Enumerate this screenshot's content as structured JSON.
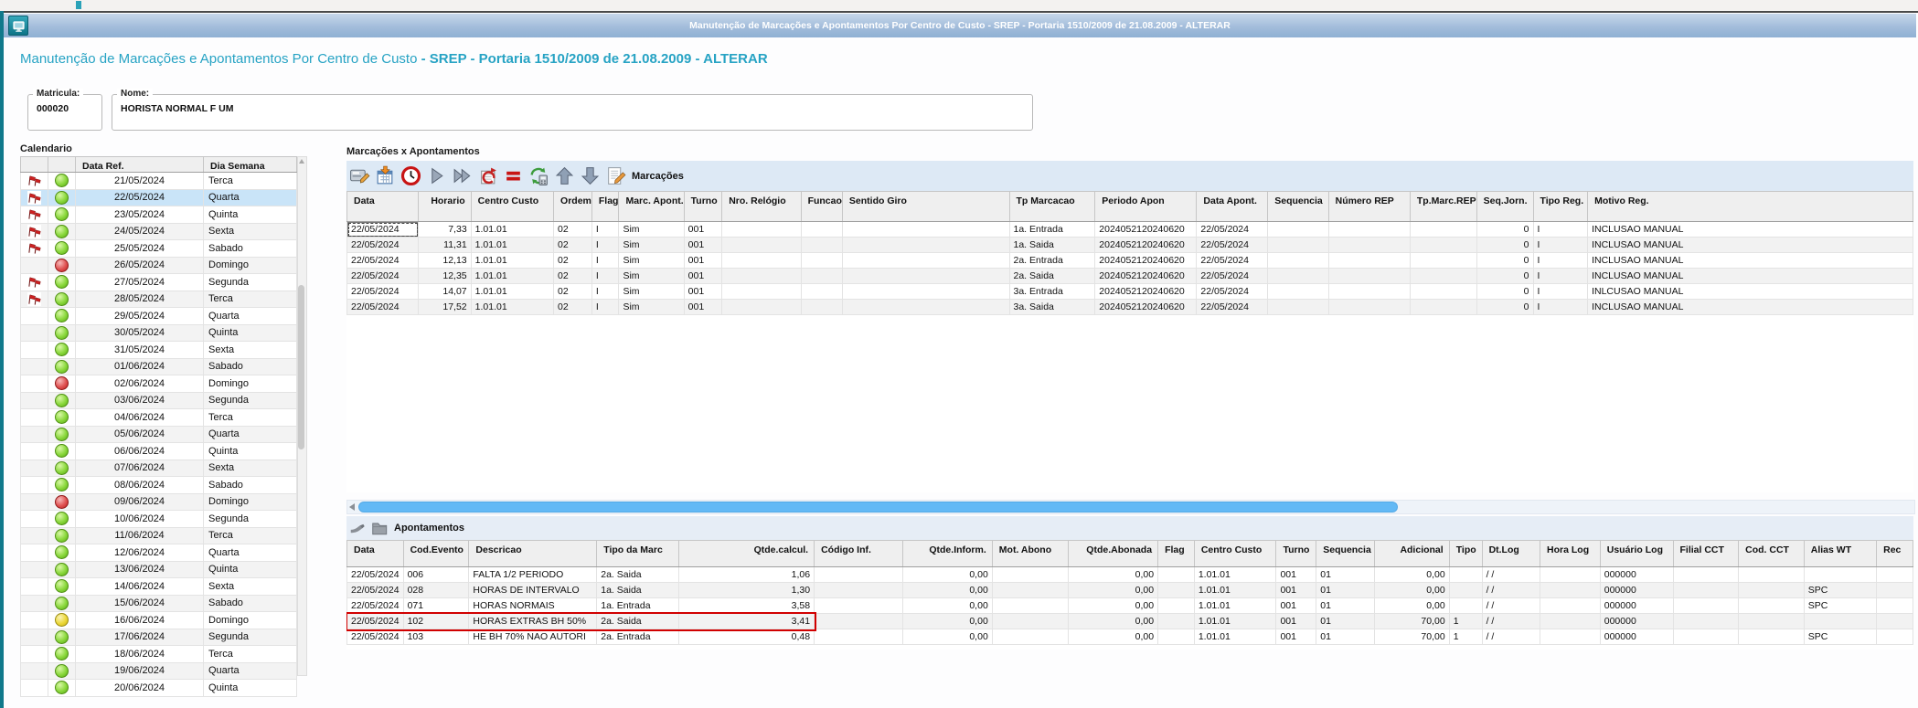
{
  "window": {
    "title": "Manutenção de Marcações e Apontamentos Por Centro de Custo - SREP - Portaria 1510/2009 de 21.08.2009 - ALTERAR"
  },
  "page": {
    "title_normal": "Manutenção de Marcações e Apontamentos Por Centro de Custo ",
    "title_bold": "- SREP - Portaria 1510/2009 de 21.08.2009 - ALTERAR"
  },
  "employee": {
    "matricula_label": "Matricula:",
    "matricula": "000020",
    "nome_label": "Nome:",
    "nome": "HORISTA NORMAL F UM"
  },
  "calendar": {
    "title": "Calendario",
    "columns": [
      "Data Ref.",
      "Dia Semana"
    ],
    "rows": [
      {
        "date": "21/05/2024",
        "day": "Terca",
        "status": "green",
        "flag": true,
        "selected": false
      },
      {
        "date": "22/05/2024",
        "day": "Quarta",
        "status": "green",
        "flag": true,
        "selected": true
      },
      {
        "date": "23/05/2024",
        "day": "Quinta",
        "status": "green",
        "flag": true,
        "selected": false
      },
      {
        "date": "24/05/2024",
        "day": "Sexta",
        "status": "green",
        "flag": true,
        "selected": false
      },
      {
        "date": "25/05/2024",
        "day": "Sabado",
        "status": "green",
        "flag": true,
        "selected": false
      },
      {
        "date": "26/05/2024",
        "day": "Domingo",
        "status": "red",
        "flag": false,
        "selected": false
      },
      {
        "date": "27/05/2024",
        "day": "Segunda",
        "status": "green",
        "flag": true,
        "selected": false
      },
      {
        "date": "28/05/2024",
        "day": "Terca",
        "status": "green",
        "flag": true,
        "selected": false
      },
      {
        "date": "29/05/2024",
        "day": "Quarta",
        "status": "green",
        "flag": false,
        "selected": false
      },
      {
        "date": "30/05/2024",
        "day": "Quinta",
        "status": "green",
        "flag": false,
        "selected": false
      },
      {
        "date": "31/05/2024",
        "day": "Sexta",
        "status": "green",
        "flag": false,
        "selected": false
      },
      {
        "date": "01/06/2024",
        "day": "Sabado",
        "status": "green",
        "flag": false,
        "selected": false
      },
      {
        "date": "02/06/2024",
        "day": "Domingo",
        "status": "red",
        "flag": false,
        "selected": false
      },
      {
        "date": "03/06/2024",
        "day": "Segunda",
        "status": "green",
        "flag": false,
        "selected": false
      },
      {
        "date": "04/06/2024",
        "day": "Terca",
        "status": "green",
        "flag": false,
        "selected": false
      },
      {
        "date": "05/06/2024",
        "day": "Quarta",
        "status": "green",
        "flag": false,
        "selected": false
      },
      {
        "date": "06/06/2024",
        "day": "Quinta",
        "status": "green",
        "flag": false,
        "selected": false
      },
      {
        "date": "07/06/2024",
        "day": "Sexta",
        "status": "green",
        "flag": false,
        "selected": false
      },
      {
        "date": "08/06/2024",
        "day": "Sabado",
        "status": "green",
        "flag": false,
        "selected": false
      },
      {
        "date": "09/06/2024",
        "day": "Domingo",
        "status": "red",
        "flag": false,
        "selected": false
      },
      {
        "date": "10/06/2024",
        "day": "Segunda",
        "status": "green",
        "flag": false,
        "selected": false
      },
      {
        "date": "11/06/2024",
        "day": "Terca",
        "status": "green",
        "flag": false,
        "selected": false
      },
      {
        "date": "12/06/2024",
        "day": "Quarta",
        "status": "green",
        "flag": false,
        "selected": false
      },
      {
        "date": "13/06/2024",
        "day": "Quinta",
        "status": "green",
        "flag": false,
        "selected": false
      },
      {
        "date": "14/06/2024",
        "day": "Sexta",
        "status": "green",
        "flag": false,
        "selected": false
      },
      {
        "date": "15/06/2024",
        "day": "Sabado",
        "status": "green",
        "flag": false,
        "selected": false
      },
      {
        "date": "16/06/2024",
        "day": "Domingo",
        "status": "yellow",
        "flag": false,
        "selected": false
      },
      {
        "date": "17/06/2024",
        "day": "Segunda",
        "status": "green",
        "flag": false,
        "selected": false
      },
      {
        "date": "18/06/2024",
        "day": "Terca",
        "status": "green",
        "flag": false,
        "selected": false
      },
      {
        "date": "19/06/2024",
        "day": "Quarta",
        "status": "green",
        "flag": false,
        "selected": false
      },
      {
        "date": "20/06/2024",
        "day": "Quinta",
        "status": "green",
        "flag": false,
        "selected": false
      }
    ]
  },
  "marcacoes": {
    "section_title": "Marcações x Apontamentos",
    "grid_title": "Marcações",
    "toolbar_icons": [
      "edit-card-icon",
      "calendar-insert-icon",
      "clock-icon",
      "play-icon",
      "fast-forward-icon",
      "undo-document-icon",
      "equals-icon",
      "recalculate-icon",
      "arrow-up-icon",
      "arrow-down-icon",
      "edit-note-icon"
    ],
    "columns": [
      "Data",
      "Horario",
      "Centro Custo",
      "Ordem",
      "Flag",
      "Marc. Apont.",
      "Turno",
      "Nro. Relógio",
      "Funcao",
      "Sentido Giro",
      "Tp Marcacao",
      "Periodo Apon",
      "Data Apont.",
      "Sequencia",
      "Número REP",
      "Tp.Marc.REP",
      "Seq.Jorn.",
      "Tipo Reg.",
      "Motivo Reg."
    ],
    "rows": [
      [
        "22/05/2024",
        "7,33",
        "1.01.01",
        "02",
        "I",
        "Sim",
        "001",
        "",
        "",
        "",
        "1a. Entrada",
        "2024052120240620",
        "22/05/2024",
        "",
        "",
        "",
        "0",
        "I",
        "INCLUSAO MANUAL"
      ],
      [
        "22/05/2024",
        "11,31",
        "1.01.01",
        "02",
        "I",
        "Sim",
        "001",
        "",
        "",
        "",
        "1a. Saida",
        "2024052120240620",
        "22/05/2024",
        "",
        "",
        "",
        "0",
        "I",
        "INCLUSAO MANUAL"
      ],
      [
        "22/05/2024",
        "12,13",
        "1.01.01",
        "02",
        "I",
        "Sim",
        "001",
        "",
        "",
        "",
        "2a. Entrada",
        "2024052120240620",
        "22/05/2024",
        "",
        "",
        "",
        "0",
        "I",
        "INCLUSAO MANUAL"
      ],
      [
        "22/05/2024",
        "12,35",
        "1.01.01",
        "02",
        "I",
        "Sim",
        "001",
        "",
        "",
        "",
        "2a. Saida",
        "2024052120240620",
        "22/05/2024",
        "",
        "",
        "",
        "0",
        "I",
        "INCLUSAO MANUAL"
      ],
      [
        "22/05/2024",
        "14,07",
        "1.01.01",
        "02",
        "I",
        "Sim",
        "001",
        "",
        "",
        "",
        "3a. Entrada",
        "2024052120240620",
        "22/05/2024",
        "",
        "",
        "",
        "0",
        "I",
        "INLCUSAO MANUAL"
      ],
      [
        "22/05/2024",
        "17,52",
        "1.01.01",
        "02",
        "I",
        "Sim",
        "001",
        "",
        "",
        "",
        "3a. Saida",
        "2024052120240620",
        "22/05/2024",
        "",
        "",
        "",
        "0",
        "I",
        "INCLUSAO MANUAL"
      ]
    ]
  },
  "apontamentos": {
    "grid_title": "Apontamentos",
    "toolbar_icons": [
      "pointer-hand-icon",
      "folder-icon"
    ],
    "columns": [
      "Data",
      "Cod.Evento",
      "Descricao",
      "Tipo da Marc",
      "Qtde.calcul.",
      "Código Inf.",
      "Qtde.Inform.",
      "Mot. Abono",
      "Qtde.Abonada",
      "Flag",
      "Centro Custo",
      "Turno",
      "Sequencia",
      "Adicional",
      "Tipo",
      "Dt.Log",
      "Hora Log",
      "Usuário Log",
      "Filial CCT",
      "Cod. CCT",
      "Alias WT",
      "Rec"
    ],
    "rows": [
      [
        "22/05/2024",
        "006",
        "FALTA 1/2 PERIODO",
        "2a. Saida",
        "1,06",
        "",
        "0,00",
        "",
        "0,00",
        "",
        "1.01.01",
        "001",
        "01",
        "0,00",
        "",
        "/ /",
        "",
        "000000",
        "",
        "",
        "",
        ""
      ],
      [
        "22/05/2024",
        "028",
        "HORAS DE INTERVALO",
        "1a. Saida",
        "1,30",
        "",
        "0,00",
        "",
        "0,00",
        "",
        "1.01.01",
        "001",
        "01",
        "0,00",
        "",
        "/ /",
        "",
        "000000",
        "",
        "",
        "SPC",
        ""
      ],
      [
        "22/05/2024",
        "071",
        "HORAS NORMAIS",
        "1a. Entrada",
        "3,58",
        "",
        "0,00",
        "",
        "0,00",
        "",
        "1.01.01",
        "001",
        "01",
        "0,00",
        "",
        "/ /",
        "",
        "000000",
        "",
        "",
        "SPC",
        ""
      ],
      [
        "22/05/2024",
        "102",
        "HORAS EXTRAS BH 50%",
        "2a. Saida",
        "3,41",
        "",
        "0,00",
        "",
        "0,00",
        "",
        "1.01.01",
        "001",
        "01",
        "70,00",
        "1",
        "/ /",
        "",
        "000000",
        "",
        "",
        "",
        ""
      ],
      [
        "22/05/2024",
        "103",
        "HE BH 70% NAO AUTORI",
        "2a. Entrada",
        "0,48",
        "",
        "0,00",
        "",
        "0,00",
        "",
        "1.01.01",
        "001",
        "01",
        "70,00",
        "1",
        "/ /",
        "",
        "000000",
        "",
        "",
        "SPC",
        ""
      ]
    ],
    "highlight": {
      "row_index": 3,
      "col_span": 5,
      "color": "#d10000"
    }
  },
  "colors": {
    "titlebar_gradient_top": "#c6d7ea",
    "titlebar_gradient_bottom": "#8fb0d3",
    "page_title": "#27a3c4",
    "left_edge_bar": "#10798b",
    "selected_row": "#c9e4f8",
    "scroll_thumb_blue": "#63b9f5",
    "status_green": "#8ad83c",
    "status_red": "#e05252",
    "status_yellow": "#ecd839"
  }
}
